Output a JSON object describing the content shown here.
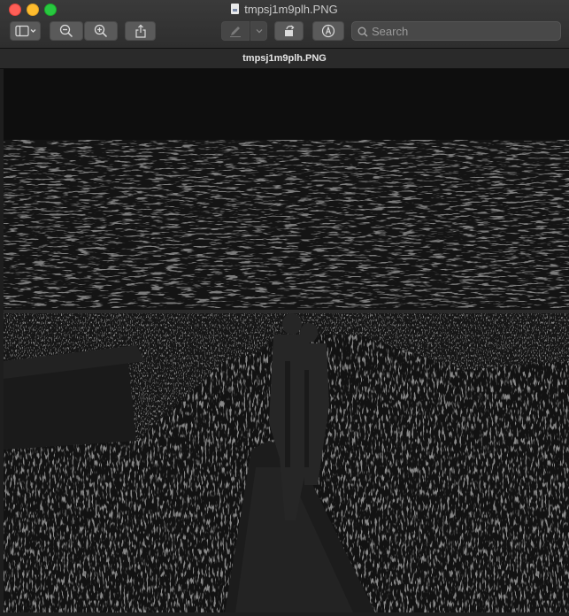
{
  "window": {
    "title": "tmpsj1m9plh.PNG",
    "document_tab": "tmpsj1m9plh.PNG"
  },
  "toolbar": {
    "search_placeholder": "Search"
  },
  "icons": {
    "sidebar": "sidebar-toggle-icon",
    "zoom_out": "zoom-out-icon",
    "zoom_in": "zoom-in-icon",
    "share": "share-icon",
    "markup": "pen-icon",
    "rotate": "rotate-icon",
    "annotate": "markup-icon",
    "search": "search-icon"
  },
  "colors": {
    "close": "#fe5f57",
    "minimize": "#febc2e",
    "maximize": "#28c840"
  }
}
